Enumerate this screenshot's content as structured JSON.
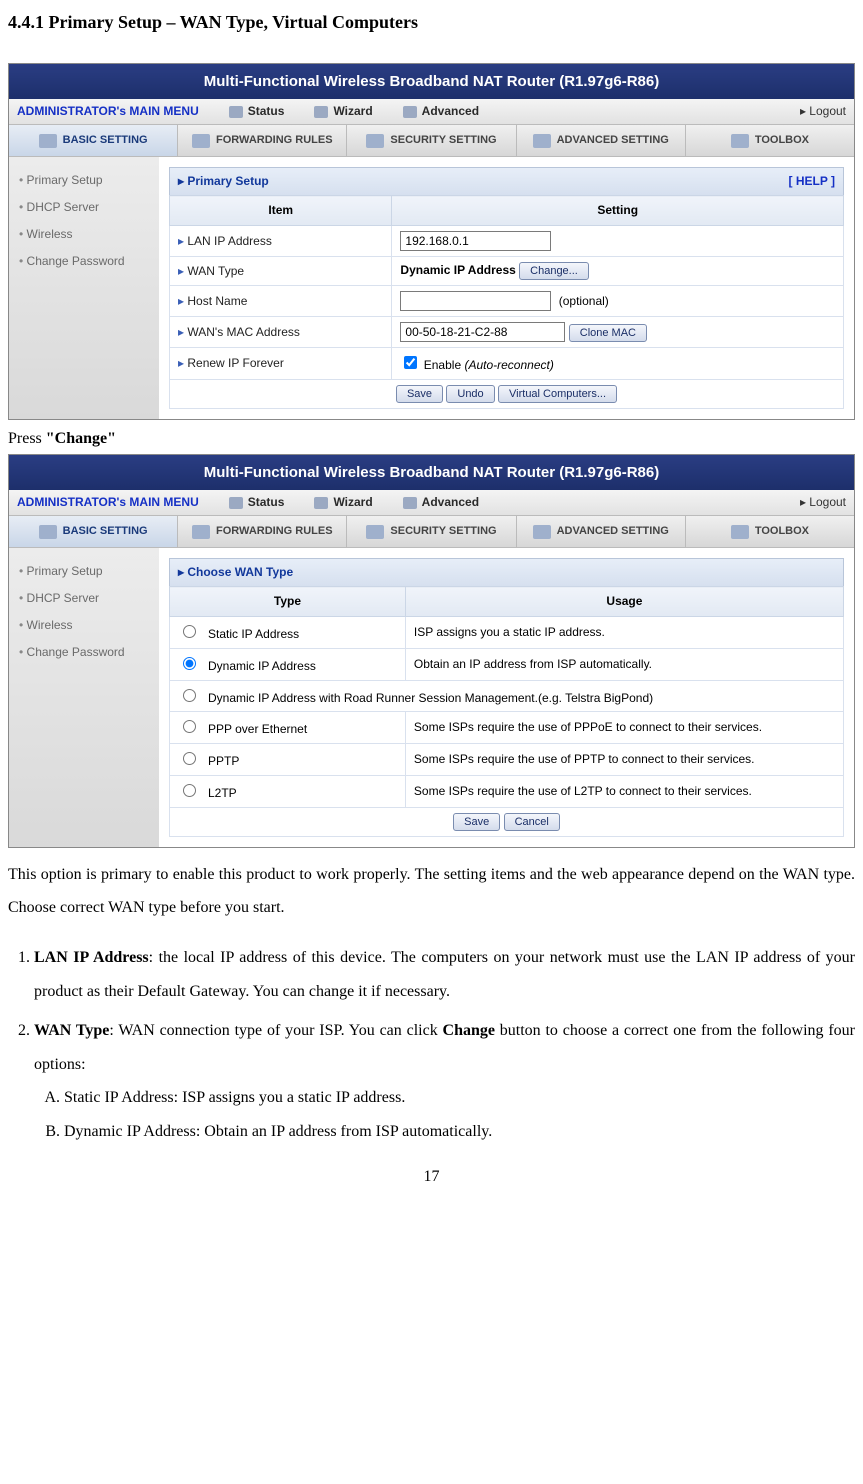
{
  "doc": {
    "section_title": "4.4.1 Primary Setup – WAN Type, Virtual Computers",
    "press_line_pre": "Press ",
    "press_line_bold": "\"Change\"",
    "para_after": "This option is primary to enable this product to work properly. The setting items and the web appearance depend on the WAN type. Choose correct WAN type before you start.",
    "li1": "LAN IP Address",
    "li1_rest": ": the local IP address of this device. The computers on your network must use the LAN IP address of your product as their Default Gateway. You can change it if necessary.",
    "li2": "WAN Type",
    "li2_mid": ": WAN connection type of your ISP. You can click ",
    "li2_changebold": "Change",
    "li2_rest": " button to choose a correct one from the following four options:",
    "liA": "Static IP Address: ISP assigns you a static IP address.",
    "liB": "Dynamic IP Address: Obtain an IP address from ISP automatically.",
    "page_num": "17"
  },
  "router": {
    "title": "Multi-Functional Wireless Broadband NAT Router (R1.97g6-R86)",
    "menu_title": "ADMINISTRATOR's MAIN MENU",
    "menu_items": [
      "Status",
      "Wizard",
      "Advanced"
    ],
    "logout": "Logout",
    "tabs": [
      "BASIC SETTING",
      "FORWARDING RULES",
      "SECURITY SETTING",
      "ADVANCED SETTING",
      "TOOLBOX"
    ],
    "sidebar": [
      "Primary Setup",
      "DHCP Server",
      "Wireless",
      "Change Password"
    ]
  },
  "panel1": {
    "title": "Primary Setup",
    "help": "[ HELP ]",
    "th_item": "Item",
    "th_setting": "Setting",
    "rows": {
      "lan_label": "LAN IP Address",
      "lan_value": "192.168.0.1",
      "wan_label": "WAN Type",
      "wan_value": "Dynamic IP Address",
      "wan_change_btn": "Change...",
      "host_label": "Host Name",
      "host_value": "",
      "host_suffix": "(optional)",
      "mac_label": "WAN's MAC Address",
      "mac_value": "00-50-18-21-C2-88",
      "clone_btn": "Clone MAC",
      "renew_label": "Renew IP Forever",
      "renew_text": "Enable ",
      "renew_ital": "(Auto-reconnect)"
    },
    "buttons": [
      "Save",
      "Undo",
      "Virtual Computers..."
    ]
  },
  "panel2": {
    "title": "Choose WAN Type",
    "th_type": "Type",
    "th_usage": "Usage",
    "options": [
      {
        "label": "Static IP Address",
        "usage": "ISP assigns you a static IP address.",
        "checked": false
      },
      {
        "label": "Dynamic IP Address",
        "usage": "Obtain an IP address from ISP automatically.",
        "checked": true
      },
      {
        "label": "Dynamic IP Address with Road Runner Session Management.(e.g. Telstra BigPond)",
        "usage": "",
        "checked": false
      },
      {
        "label": "PPP over Ethernet",
        "usage": "Some ISPs require the use of PPPoE to connect to their services.",
        "checked": false
      },
      {
        "label": "PPTP",
        "usage": "Some ISPs require the use of PPTP to connect to their services.",
        "checked": false
      },
      {
        "label": "L2TP",
        "usage": "Some ISPs require the use of L2TP to connect to their services.",
        "checked": false
      }
    ],
    "buttons": [
      "Save",
      "Cancel"
    ]
  }
}
